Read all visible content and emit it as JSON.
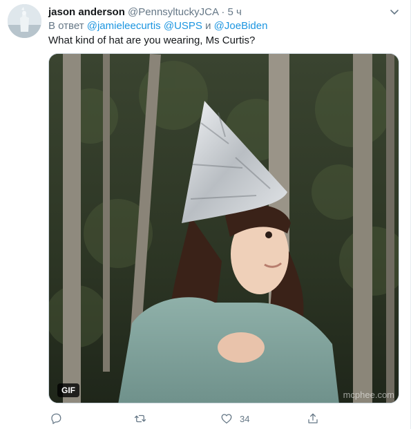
{
  "tweet": {
    "author_name": "jason anderson",
    "author_handle": "@PennsyltuckyJCA",
    "separator": "·",
    "time": "5 ч",
    "reply_prefix": "В ответ",
    "reply_mentions": [
      "@jamieleecurtis",
      "@USPS"
    ],
    "reply_conjunction": "и",
    "reply_last_mention": "@JoeBiden",
    "text": "What kind of hat are you wearing, Ms Curtis?",
    "media": {
      "badge": "GIF",
      "watermark": "mcphee.com"
    },
    "actions": {
      "reply_icon": "reply-icon",
      "retweet_icon": "retweet-icon",
      "like_icon": "heart-icon",
      "like_count": "34",
      "share_icon": "share-icon"
    }
  },
  "colors": {
    "link": "#1b95e0",
    "secondary_text": "#657786",
    "primary_text": "#14171a"
  }
}
